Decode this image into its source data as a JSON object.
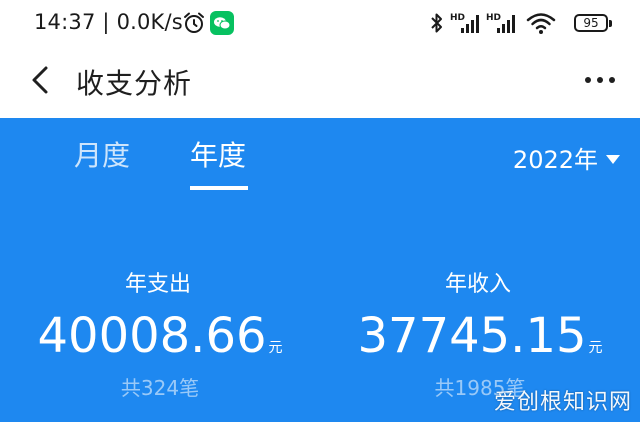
{
  "status_bar": {
    "time": "14:37",
    "network_speed": "0.0K/s",
    "alarm_icon": "alarm-clock-icon",
    "wechat_icon": "wechat-icon",
    "network_labels": [
      "HD",
      "HD"
    ],
    "battery_level": "95"
  },
  "header": {
    "back_icon": "chevron-left-icon",
    "title": "收支分析",
    "more_icon": "more-dots-icon"
  },
  "tabs": [
    {
      "label": "月度",
      "active": false
    },
    {
      "label": "年度",
      "active": true
    }
  ],
  "year_selector": {
    "value": "2022年",
    "icon": "caret-down-icon"
  },
  "summary": {
    "expense": {
      "label": "年支出",
      "amount": "40008.66",
      "unit": "元",
      "count": "共324笔"
    },
    "income": {
      "label": "年收入",
      "amount": "37745.15",
      "unit": "元",
      "count": "共1985笔"
    }
  },
  "watermark": "爱创根知识网",
  "colors": {
    "panel_blue": "#1e88f0",
    "wechat_green": "#07c160",
    "text_dark": "#1f1f1f"
  }
}
